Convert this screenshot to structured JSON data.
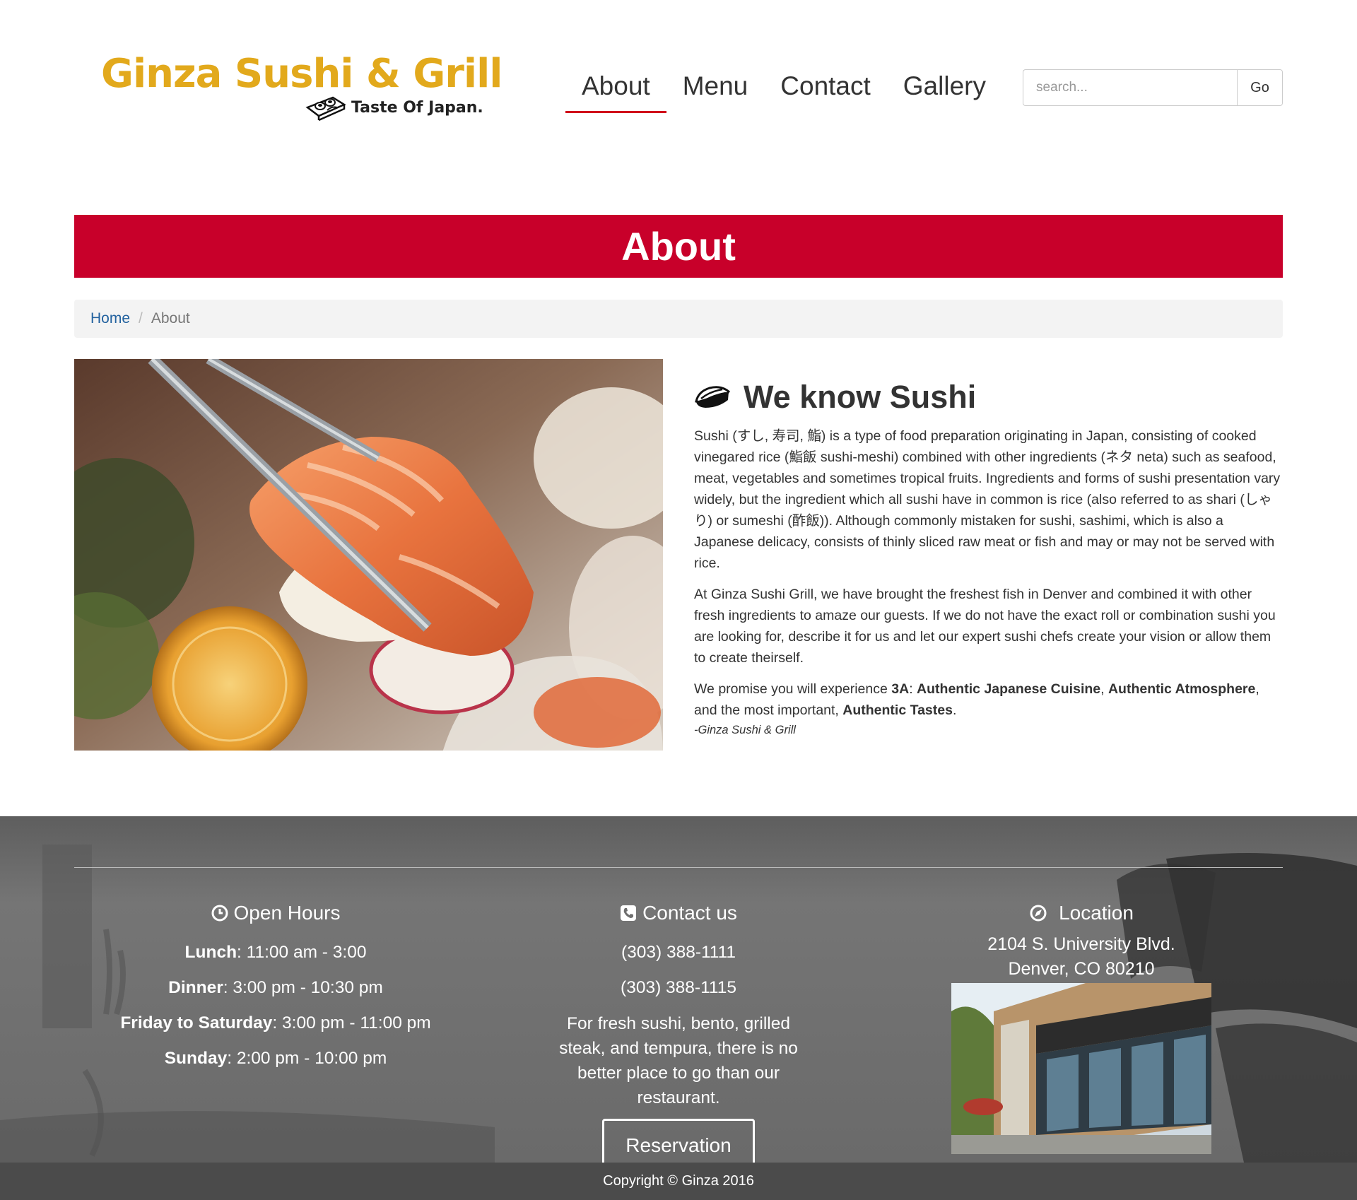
{
  "brand": {
    "name": "Ginza Sushi & Grill",
    "tagline": "Taste Of Japan.",
    "color": "#e2a91c"
  },
  "nav": {
    "items": [
      {
        "label": "About",
        "active": true
      },
      {
        "label": "Menu"
      },
      {
        "label": "Contact"
      },
      {
        "label": "Gallery"
      }
    ]
  },
  "search": {
    "placeholder": "search...",
    "value": "",
    "button": "Go"
  },
  "banner": {
    "title": "About",
    "color": "#c8002a"
  },
  "breadcrumb": {
    "home": "Home",
    "separator": "/",
    "current": "About"
  },
  "article": {
    "title": "We know Sushi",
    "icon": "sushi-icon",
    "p1": "Sushi (すし, 寿司, 鮨) is a type of food preparation originating in Japan, consisting of cooked vinegared rice (鮨飯 sushi-meshi) combined with other ingredients (ネタ neta) such as seafood, meat, vegetables and sometimes tropical fruits. Ingredients and forms of sushi presentation vary widely, but the ingredient which all sushi have in common is rice (also referred to as shari (しゃり) or sumeshi (酢飯)). Although commonly mistaken for sushi, sashimi, which is also a Japanese delicacy, consists of thinly sliced raw meat or fish and may or may not be served with rice.",
    "p2": "At Ginza Sushi Grill, we have brought the freshest fish in Denver and combined it with other fresh ingredients to amaze our guests. If we do not have the exact roll or combination sushi you are looking for, describe it for us and let our expert sushi chefs create your vision or allow them to create theirself.",
    "promise": {
      "intro": "We promise you will experience ",
      "bold1": "3A",
      "sep1": ": ",
      "bold2": "Authentic Japanese Cuisine",
      "sep2": ", ",
      "bold3": "Authentic Atmosphere",
      "sep3": ", and the most important, ",
      "bold4": "Authentic Tastes",
      "end": "."
    },
    "signature": "-Ginza Sushi & Grill"
  },
  "footer": {
    "hours": {
      "title": "Open Hours",
      "icon": "clock-icon",
      "rows": [
        {
          "label": "Lunch",
          "value": ": 11:00 am - 3:00"
        },
        {
          "label": "Dinner",
          "value": ": 3:00 pm - 10:30 pm"
        },
        {
          "label": "Friday to Saturday",
          "value": ": 3:00 pm - 11:00 pm"
        },
        {
          "label": "Sunday",
          "value": ": 2:00 pm - 10:00 pm"
        }
      ]
    },
    "contact": {
      "title": "Contact us",
      "icon": "phone-icon",
      "phone1": "(303) 388-1111",
      "phone2": "(303) 388-1115",
      "description": "For fresh sushi, bento, grilled steak, and tempura, there is no better place to go than our restaurant.",
      "button": "Reservation"
    },
    "location": {
      "title": "Location",
      "icon": "location-icon",
      "line1": "2104 S. University Blvd.",
      "line2": "Denver, CO 80210"
    }
  },
  "copyright": "Copyright © Ginza 2016"
}
